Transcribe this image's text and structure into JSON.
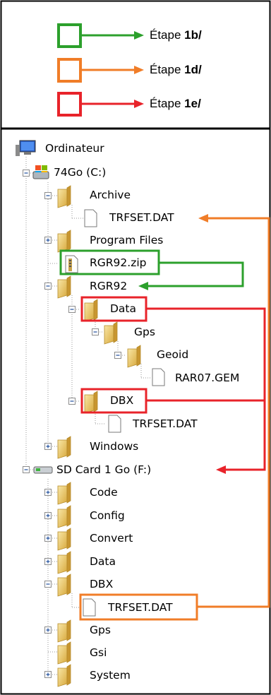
{
  "legend": [
    {
      "prefix": "Étape ",
      "bold": "1b/",
      "color": "#2ca02c"
    },
    {
      "prefix": "Étape ",
      "bold": "1d/",
      "color": "#f07d28"
    },
    {
      "prefix": "Étape ",
      "bold": "1e/",
      "color": "#e8232a"
    }
  ],
  "tree": {
    "computer": "Ordinateur",
    "drive_c": "74Go (C:)",
    "archive": "Archive",
    "archive_file": "TRFSET.DAT",
    "program_files": "Program Files",
    "zip": "RGR92.zip",
    "rgr92": "RGR92",
    "data": "Data",
    "gps": "Gps",
    "geoid": "Geoid",
    "gem": "RAR07.GEM",
    "dbx": "DBX",
    "dbx_file": "TRFSET.DAT",
    "windows": "Windows",
    "drive_f": "SD Card 1 Go (F:)",
    "f_code": "Code",
    "f_config": "Config",
    "f_convert": "Convert",
    "f_data": "Data",
    "f_dbx": "DBX",
    "f_dbx_file": "TRFSET.DAT",
    "f_gps": "Gps",
    "f_gsi": "Gsi",
    "f_system": "System"
  },
  "colors": {
    "green": "#2ca02c",
    "orange": "#f07d28",
    "red": "#e8232a",
    "folder": "#e8c46a"
  },
  "icons": [
    "computer-icon",
    "hard-drive-icon",
    "sd-card-icon",
    "folder-icon",
    "file-icon",
    "zip-icon",
    "expand-icon",
    "collapse-icon",
    "arrow-icon"
  ]
}
